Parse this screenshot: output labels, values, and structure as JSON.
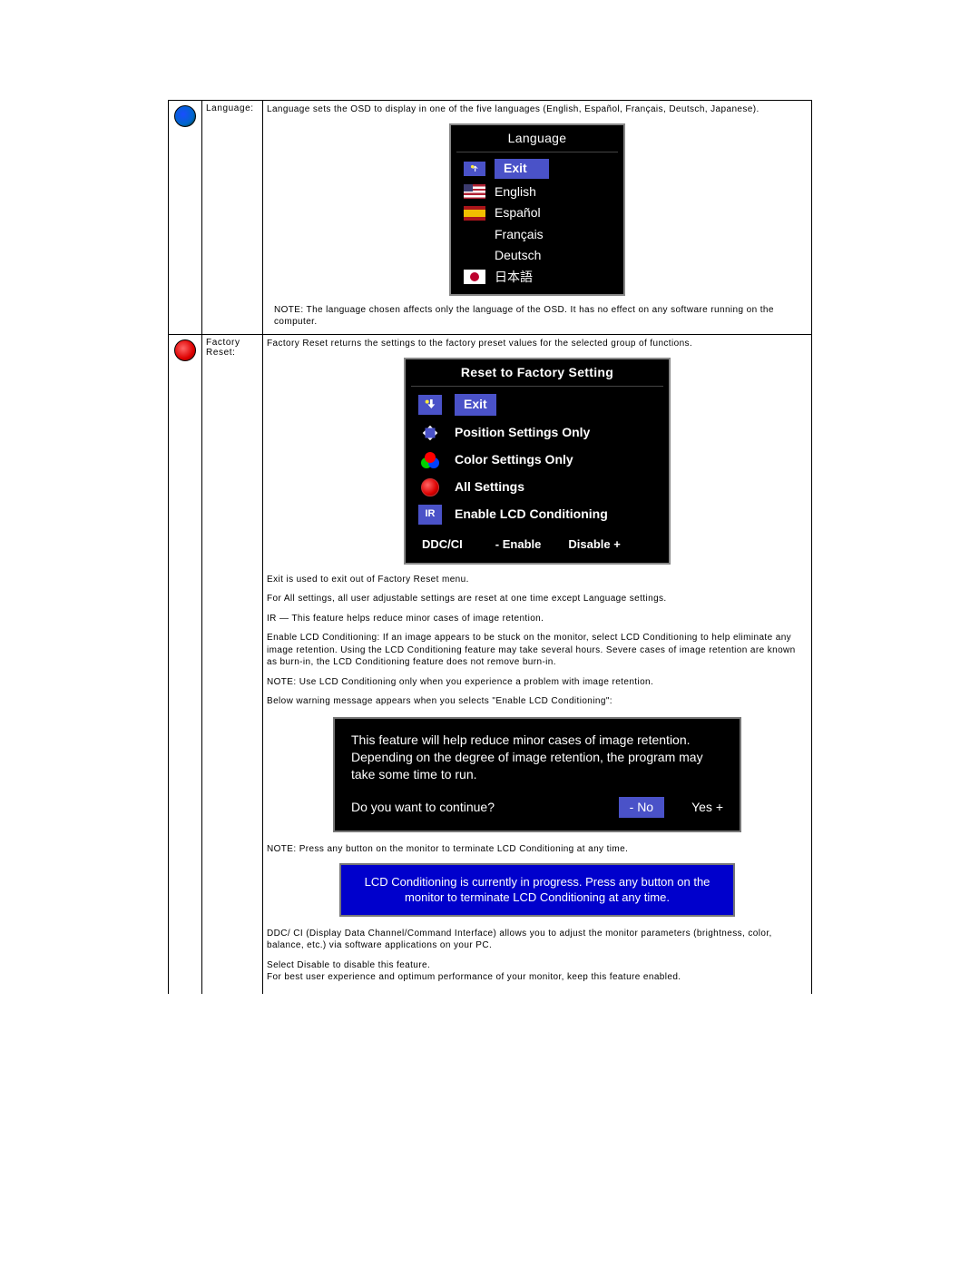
{
  "language": {
    "label": "Language:",
    "intro": "Language sets the OSD to display in one of the five languages (English, Español, Français, Deutsch, Japanese).",
    "menu_title": "Language",
    "items": [
      {
        "kind": "exit",
        "label": "Exit"
      },
      {
        "kind": "us",
        "label": "English"
      },
      {
        "kind": "es",
        "label": "Español"
      },
      {
        "kind": "fr",
        "label": "Français"
      },
      {
        "kind": "de",
        "label": "Deutsch"
      },
      {
        "kind": "jp",
        "label": "日本語"
      }
    ],
    "note": "NOTE: The language chosen affects only the language of the OSD. It has no effect on any software running on the computer."
  },
  "reset": {
    "label": "Factory Reset:",
    "intro": "Factory Reset returns the settings to the factory preset values for the selected group of functions.",
    "menu_title": "Reset to Factory Setting",
    "items": [
      {
        "kind": "exit",
        "label": "Exit"
      },
      {
        "kind": "pos",
        "label": "Position Settings Only"
      },
      {
        "kind": "color",
        "label": "Color Settings Only"
      },
      {
        "kind": "all",
        "label": "All Settings"
      },
      {
        "kind": "ir",
        "label": "Enable LCD Conditioning"
      }
    ],
    "ddcci": {
      "label": "DDC/CI",
      "minus": "- Enable",
      "plus": "Disable +"
    },
    "p_exit": "Exit is used to exit out of Factory Reset menu.",
    "p_all": "For All settings, all user adjustable settings are reset at one time except Language settings.",
    "p_ir": "IR —   This feature helps reduce minor cases of image retention.",
    "p_cond": "Enable LCD Conditioning: If an image appears to be stuck on the monitor, select LCD Conditioning to help eliminate any image retention. Using the LCD Conditioning feature may take several hours. Severe cases of image retention are known as burn-in, the LCD Conditioning feature does not remove burn-in.",
    "note_cond": " NOTE: Use LCD Conditioning only when you experience a problem with image retention.",
    "p_below": "Below warning message appears when you selects \"Enable LCD Conditioning\":",
    "warn_msg": "This feature will help reduce minor cases of image retention. Depending on the degree of image retention, the program may take some time to run.",
    "warn_q": "Do you want to continue?",
    "warn_no": "- No",
    "warn_yes": "Yes +",
    "note_press": "NOTE: Press any button on the monitor to terminate LCD Conditioning at any time.",
    "progress": "LCD Conditioning is currently in progress.  Press any button on the monitor to terminate LCD Conditioning at any time.",
    "p_ddcci": "DDC/ CI (Display Data Channel/Command Interface) allows you to adjust the monitor parameters (brightness, color, balance, etc.)  via software applications on your PC.",
    "p_disable": "Select Disable to disable this feature.",
    "p_enable": "For best user experience and optimum performance of your monitor, keep this feature enabled."
  }
}
